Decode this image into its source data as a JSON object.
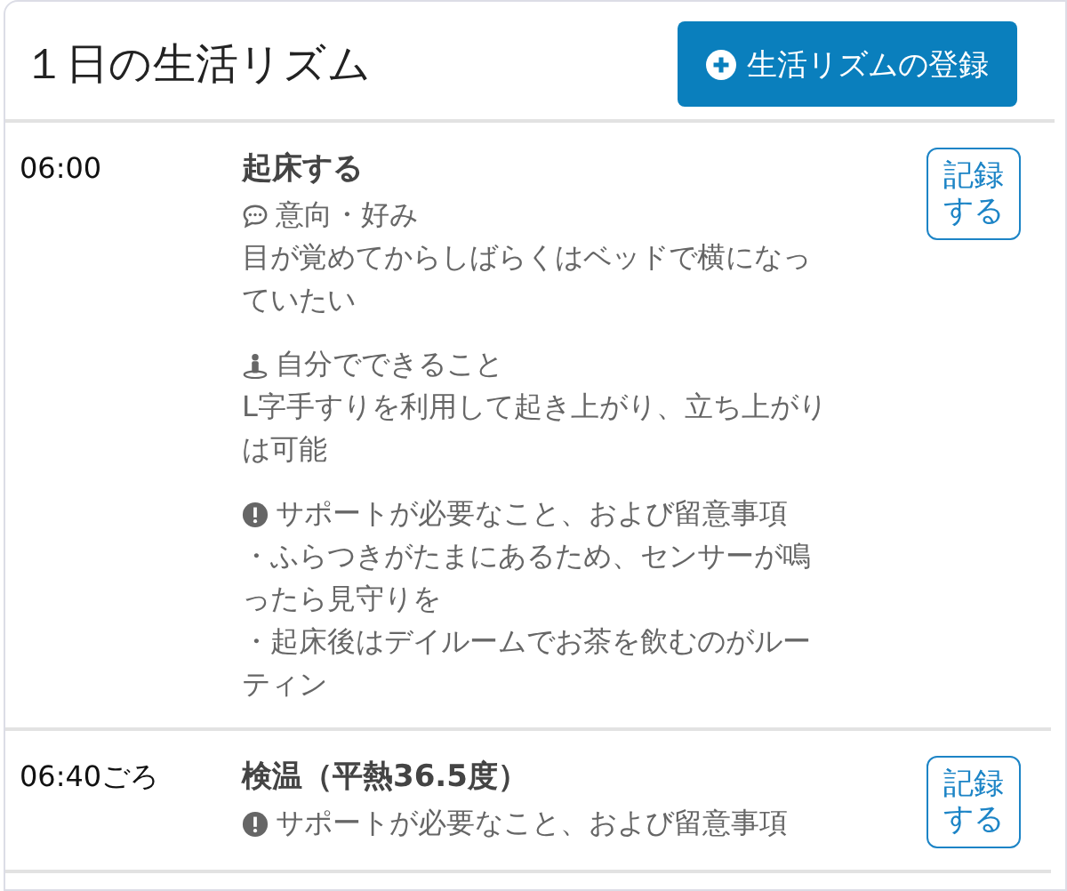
{
  "title": "１日の生活リズム",
  "add_button": {
    "label": "生活リズムの登録"
  },
  "entries": [
    {
      "time": "06:00",
      "title": "起床する",
      "record_button": [
        "記録",
        "する"
      ],
      "sections": [
        {
          "kind": "preference",
          "label": "意向・好み",
          "lines": [
            "目が覚めてからしばらくはベッドで横になっていたい"
          ]
        },
        {
          "kind": "self",
          "label": "自分でできること",
          "lines": [
            "L字手すりを利用して起き上がり、立ち上がりは可能"
          ]
        },
        {
          "kind": "support",
          "label": "サポートが必要なこと、および留意事項",
          "lines": [
            "・ふらつきがたまにあるため、センサーが鳴ったら見守りを",
            "・起床後はデイルームでお茶を飲むのがルーティン"
          ]
        }
      ]
    },
    {
      "time": "06:40ごろ",
      "title": "検温（平熱36.5度）",
      "record_button": [
        "記録",
        "する"
      ],
      "sections": [
        {
          "kind": "support",
          "label": "サポートが必要なこと、および留意事項"
        }
      ]
    }
  ]
}
